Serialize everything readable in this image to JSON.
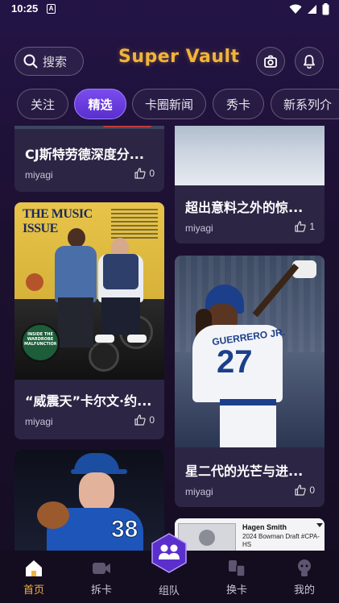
{
  "status_bar": {
    "time": "10:25",
    "notification_glyph": "A"
  },
  "header": {
    "search_label": "搜索",
    "logo_text": "Super Vault"
  },
  "tabs": [
    {
      "label": "关注",
      "active": false
    },
    {
      "label": "精选",
      "active": true
    },
    {
      "label": "卡圈新闻",
      "active": false
    },
    {
      "label": "秀卡",
      "active": false
    },
    {
      "label": "新系列介",
      "active": false
    }
  ],
  "feed": {
    "left": [
      {
        "title": "CJ斯特劳德深度分...",
        "author": "miyagi",
        "likes": "0"
      },
      {
        "title": "“威震天”卡尔文·约...",
        "author": "miyagi",
        "likes": "0",
        "magazine_headline": "THE MUSIC ISSUE",
        "magazine_badge": "INSIDE THE WARDROBE MALFUNCTION"
      },
      {
        "title": "",
        "author": "",
        "likes": ""
      }
    ],
    "right": [
      {
        "title": "超出意料之外的惊...",
        "author": "miyagi",
        "likes": "1"
      },
      {
        "title": "星二代的光芒与进...",
        "author": "miyagi",
        "likes": "0",
        "jersey_text": "GUERRERO JR.",
        "jersey_number": "27"
      },
      {
        "title": "",
        "author": "",
        "likes": "",
        "card_name": "Hagen Smith",
        "card_set": "2024 Bowman Draft #CPA-HS"
      }
    ]
  },
  "bottom_nav": [
    {
      "label": "首页",
      "icon": "home-icon",
      "active": true
    },
    {
      "label": "拆卡",
      "icon": "video-icon",
      "active": false
    },
    {
      "label": "组队",
      "icon": "team-icon",
      "active": false
    },
    {
      "label": "换卡",
      "icon": "exchange-icon",
      "active": false
    },
    {
      "label": "我的",
      "icon": "profile-icon",
      "active": false
    }
  ],
  "colors": {
    "accent": "#f0b43a",
    "tab_active": "#6a3ce0",
    "card_bg": "#2c2544"
  }
}
